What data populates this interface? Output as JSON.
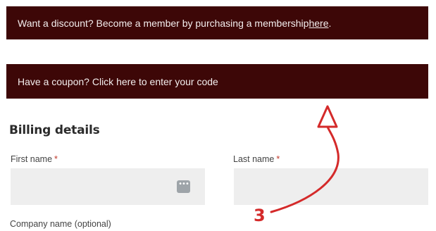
{
  "banners": {
    "discount": {
      "text_before": "Want a discount? Become a member by purchasing a membership ",
      "link": "here",
      "text_after": "."
    },
    "coupon": {
      "text": "Have a coupon? Click here to enter your code"
    }
  },
  "billing": {
    "heading": "Billing details",
    "first_name": {
      "label": "First name",
      "required_mark": "*",
      "value": ""
    },
    "last_name": {
      "label": "Last name",
      "required_mark": "*",
      "value": ""
    },
    "company_name": {
      "label": "Company name (optional)"
    },
    "autofill_icon_glyph": "•••"
  },
  "annotation": {
    "number": "3",
    "color": "#d42a2a"
  },
  "colors": {
    "banner_bg": "#3d0707",
    "field_bg": "#eeeeee",
    "required": "#c0392b"
  }
}
